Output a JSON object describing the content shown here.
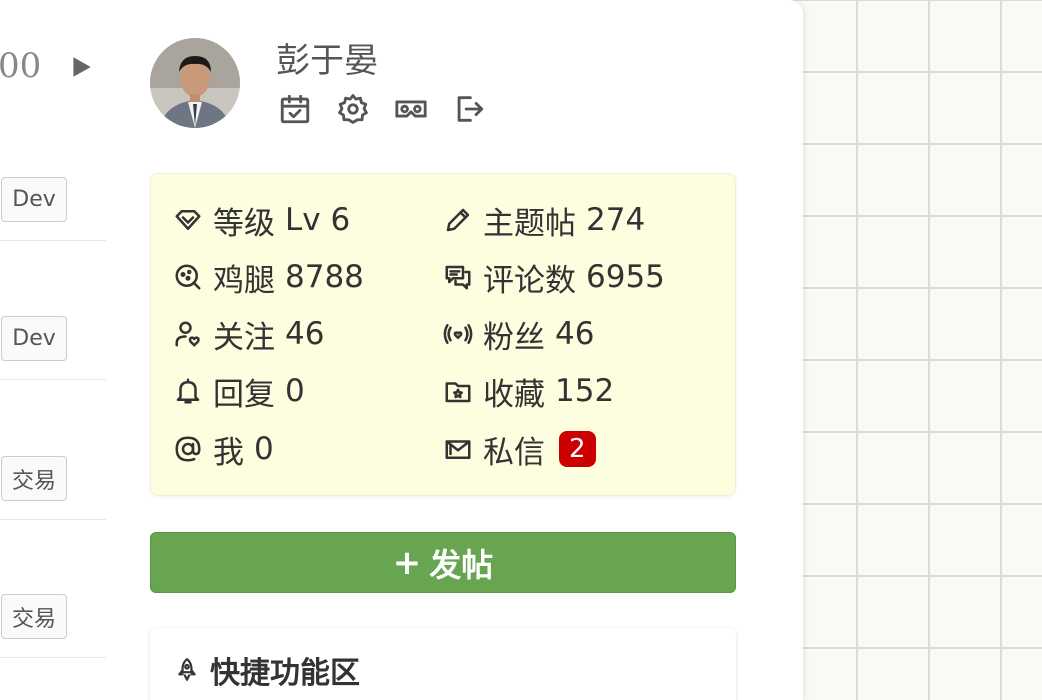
{
  "left_list": {
    "page_number": "00",
    "play_icon": "play-triangle-icon",
    "tags": [
      "Dev",
      "Dev",
      "交易",
      "交易"
    ]
  },
  "user": {
    "name": "彭于晏",
    "avatar": "user-avatar-photo",
    "actions": [
      {
        "name": "checkin-calendar-icon"
      },
      {
        "name": "settings-gear-icon"
      },
      {
        "name": "vr-glasses-icon"
      },
      {
        "name": "logout-icon"
      }
    ]
  },
  "stats": {
    "level": {
      "label": "等级",
      "value": "Lv 6"
    },
    "topics": {
      "label": "主题帖",
      "value": "274"
    },
    "drumsticks": {
      "label": "鸡腿",
      "value": "8788"
    },
    "comments": {
      "label": "评论数",
      "value": "6955"
    },
    "following": {
      "label": "关注",
      "value": "46"
    },
    "fans": {
      "label": "粉丝",
      "value": "46"
    },
    "replies": {
      "label": "回复",
      "value": "0"
    },
    "favorites": {
      "label": "收藏",
      "value": "152"
    },
    "mentions": {
      "label": "我",
      "value": "0"
    },
    "messages": {
      "label": "私信",
      "badge": "2"
    }
  },
  "post_button": {
    "icon": "+",
    "label": "发帖"
  },
  "quick_area": {
    "title": "快捷功能区"
  },
  "colors": {
    "stats_bg": "#fdfde0",
    "post_button": "#67a550",
    "badge": "#cc0000"
  }
}
